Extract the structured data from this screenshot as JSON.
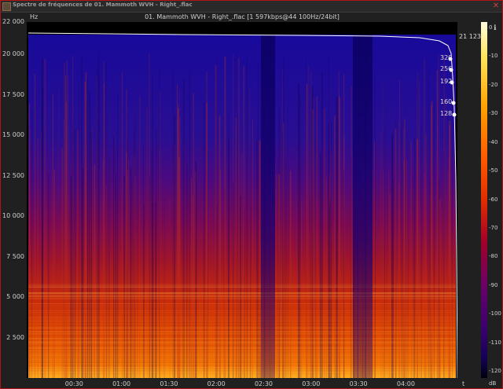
{
  "window": {
    "title": "Spectre de fréquences de 01. Mammoth WVH - Right_.flac",
    "close_glyph": "✕",
    "icon": "spectrum-app-icon"
  },
  "plot": {
    "title": "01. Mammoth WVH - Right_.flac [1 597kbps@44 100Hz/24bit]",
    "y_unit": "Hz",
    "x_unit": "t",
    "cutoff_label": "21 123",
    "bitrate_markers": [
      "320",
      "256",
      "192",
      "160",
      "128"
    ]
  },
  "colorbar": {
    "unit": "dB",
    "icon": "info-icon",
    "ticks": [
      "0",
      "-10",
      "-20",
      "-30",
      "-40",
      "-50",
      "-60",
      "-70",
      "-80",
      "-90",
      "-100",
      "-110",
      "-120"
    ]
  },
  "chart_data": {
    "type": "heatmap",
    "title": "01. Mammoth WVH - Right_.flac [1 597kbps@44 100Hz/24bit]",
    "ylabel": "Hz",
    "xlabel": "t",
    "ylim": [
      0,
      22000
    ],
    "yticks": [
      "22 000",
      "20 000",
      "17 500",
      "15 000",
      "12 500",
      "10 000",
      "7 500",
      "5 000",
      "2 500"
    ],
    "xticks": [
      "00:30",
      "01:00",
      "01:30",
      "02:00",
      "02:30",
      "03:00",
      "03:30",
      "04:00"
    ],
    "colorscale_db": [
      0,
      -120
    ],
    "cutoff_hz": 21123
  },
  "colors": {
    "accent_border": "#b11616",
    "spectrum_background": "#2a1a8a"
  }
}
